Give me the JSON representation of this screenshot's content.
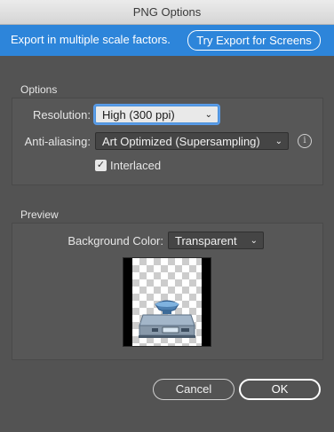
{
  "window": {
    "title": "PNG Options"
  },
  "banner": {
    "text": "Export in multiple scale factors.",
    "button_label": "Try Export for Screens"
  },
  "options": {
    "group_label": "Options",
    "resolution": {
      "label": "Resolution:",
      "value": "High (300 ppi)"
    },
    "anti_aliasing": {
      "label": "Anti-aliasing:",
      "value": "Art Optimized (Supersampling)"
    },
    "interlaced": {
      "label": "Interlaced",
      "checked": true
    }
  },
  "preview": {
    "group_label": "Preview",
    "background_color": {
      "label": "Background Color:",
      "value": "Transparent"
    }
  },
  "footer": {
    "cancel_label": "Cancel",
    "ok_label": "OK"
  },
  "icons": {
    "chevron": "chevron-down-icon",
    "info": "info-icon",
    "check": "checkmark-icon",
    "preview_art": "kitchen-scale-icon"
  },
  "colors": {
    "dialog_bg": "#535353",
    "banner_bg": "#2d85da",
    "focus_ring": "#5a9ce8"
  }
}
